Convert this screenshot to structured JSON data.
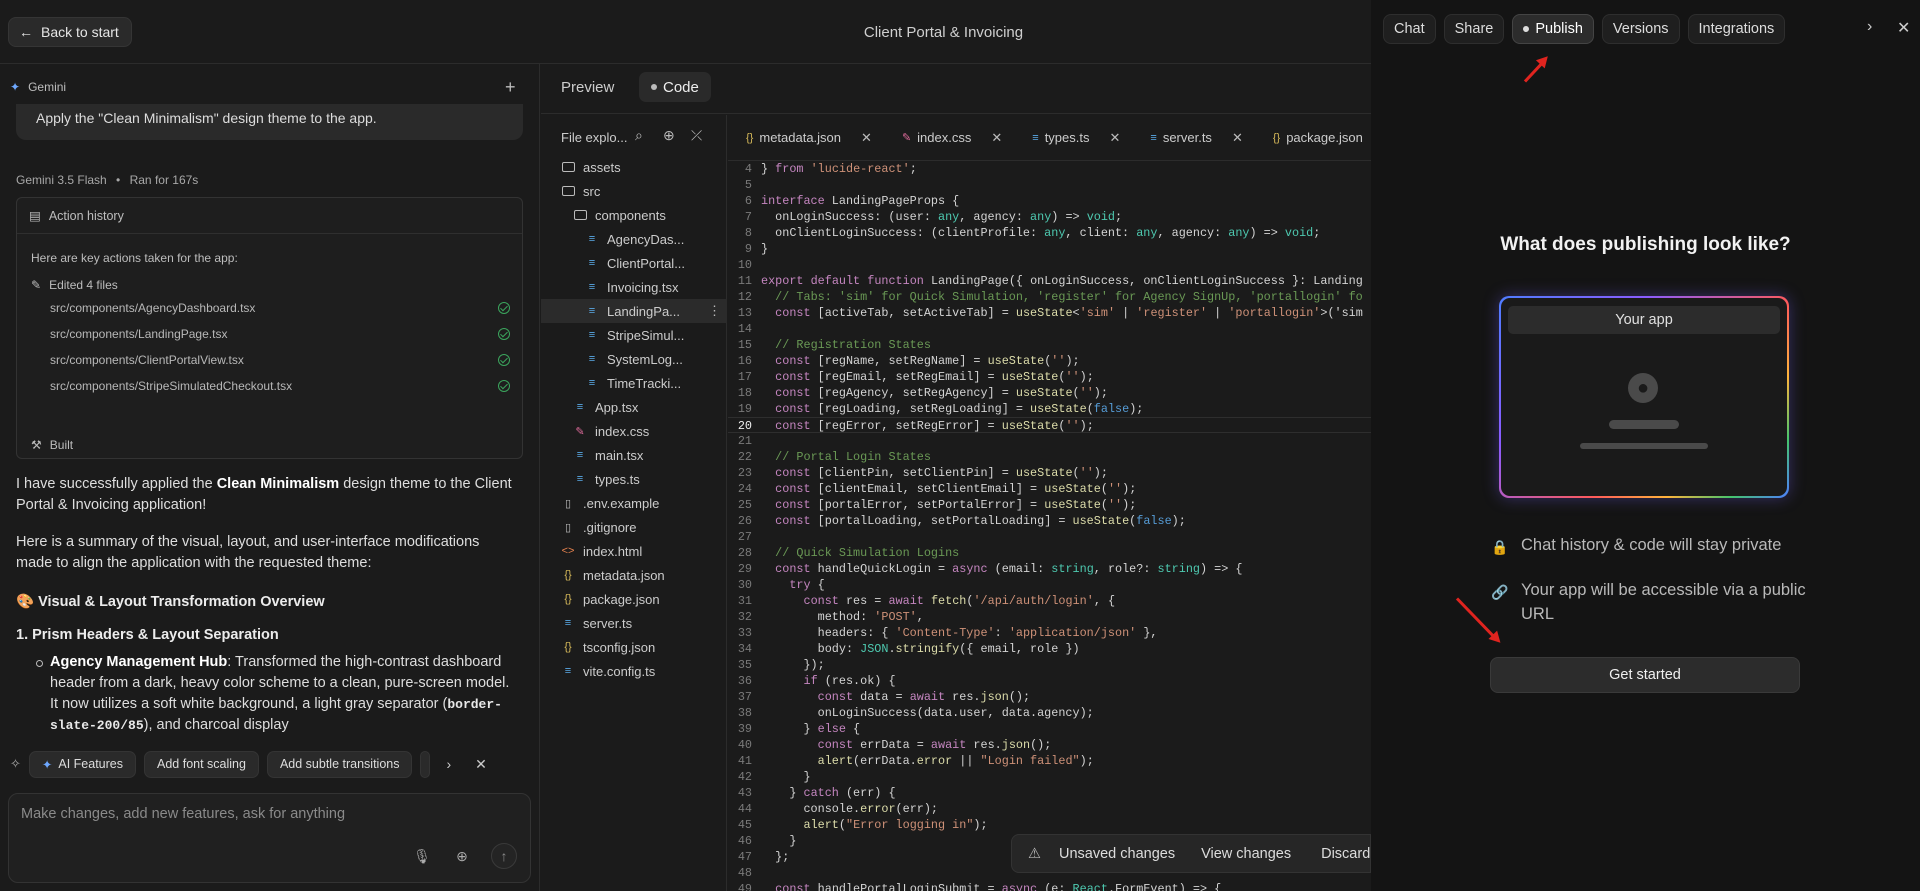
{
  "topbar": {
    "back_label": "Back to start",
    "app_title": "Client Portal & Invoicing"
  },
  "left": {
    "assistant_name": "Gemini",
    "prev_message": "Apply the \"Clean Minimalism\" design theme to the app.",
    "model": "Gemini 3.5 Flash",
    "ran_for": "Ran for 167s",
    "action_history": {
      "title": "Action history",
      "intro": "Here are key actions taken for the app:",
      "edited": "Edited 4 files",
      "files": [
        "src/components/AgencyDashboard.tsx",
        "src/components/LandingPage.tsx",
        "src/components/ClientPortalView.tsx",
        "src/components/StripeSimulatedCheckout.tsx"
      ],
      "built": "Built"
    },
    "msg": {
      "p1_a": "I have successfully applied the ",
      "p1_b": "Clean Minimalism",
      "p1_c": " design theme to the Client Portal & Invoicing application!",
      "p2": "Here is a summary of the visual, layout, and user-interface modifications made to align the application with the requested theme:",
      "overview": "🎨 Visual & Layout Transformation Overview",
      "item1": "1. Prism Headers & Layout Separation",
      "bullet_bold": "Agency Management Hub",
      "bullet_text": ": Transformed the high-contrast dashboard header from a dark, heavy color scheme to a clean, pure-screen model. It now utilizes a soft white background, a light gray separator (",
      "bullet_code": "border-slate-200/85",
      "bullet_tail": "), and charcoal display"
    },
    "suggestions": [
      "AI Features",
      "Add font scaling",
      "Add subtle transitions"
    ],
    "input_placeholder": "Make changes, add new features, ask for anything"
  },
  "mid": {
    "view_tabs": [
      "Preview",
      "Code"
    ],
    "explorer_title": "File explo...",
    "tree": [
      {
        "label": "assets",
        "type": "folder",
        "depth": 0
      },
      {
        "label": "src",
        "type": "folder",
        "depth": 0
      },
      {
        "label": "components",
        "type": "folder",
        "depth": 1
      },
      {
        "label": "AgencyDas...",
        "type": "tsx",
        "depth": 2
      },
      {
        "label": "ClientPortal...",
        "type": "tsx",
        "depth": 2
      },
      {
        "label": "Invoicing.tsx",
        "type": "tsx",
        "depth": 2
      },
      {
        "label": "LandingPa...",
        "type": "tsx",
        "depth": 2,
        "selected": true
      },
      {
        "label": "StripeSimul...",
        "type": "tsx",
        "depth": 2
      },
      {
        "label": "SystemLog...",
        "type": "tsx",
        "depth": 2
      },
      {
        "label": "TimeTracki...",
        "type": "tsx",
        "depth": 2
      },
      {
        "label": "App.tsx",
        "type": "tsx",
        "depth": 1
      },
      {
        "label": "index.css",
        "type": "css",
        "depth": 1
      },
      {
        "label": "main.tsx",
        "type": "tsx",
        "depth": 1
      },
      {
        "label": "types.ts",
        "type": "tsx",
        "depth": 1
      },
      {
        "label": ".env.example",
        "type": "file",
        "depth": 0
      },
      {
        "label": ".gitignore",
        "type": "file",
        "depth": 0
      },
      {
        "label": "index.html",
        "type": "html",
        "depth": 0
      },
      {
        "label": "metadata.json",
        "type": "json",
        "depth": 0
      },
      {
        "label": "package.json",
        "type": "json",
        "depth": 0
      },
      {
        "label": "server.ts",
        "type": "tsx",
        "depth": 0
      },
      {
        "label": "tsconfig.json",
        "type": "json",
        "depth": 0
      },
      {
        "label": "vite.config.ts",
        "type": "tsx",
        "depth": 0
      }
    ],
    "file_tabs": [
      {
        "label": "metadata.json",
        "type": "json"
      },
      {
        "label": "index.css",
        "type": "css"
      },
      {
        "label": "types.ts",
        "type": "tsx"
      },
      {
        "label": "server.ts",
        "type": "tsx"
      },
      {
        "label": "package.json",
        "type": "json"
      }
    ],
    "code_start_line": 4,
    "current_line": 20,
    "code": [
      "} from 'lucide-react';",
      "",
      "interface LandingPageProps {",
      "  onLoginSuccess: (user: any, agency: any) => void;",
      "  onClientLoginSuccess: (clientProfile: any, client: any, agency: any) => void;",
      "}",
      "",
      "export default function LandingPage({ onLoginSuccess, onClientLoginSuccess }: Landing",
      "  // Tabs: 'sim' for Quick Simulation, 'register' for Agency SignUp, 'portallogin' fo",
      "  const [activeTab, setActiveTab] = useState<'sim' | 'register' | 'portallogin'>('sim",
      "",
      "  // Registration States",
      "  const [regName, setRegName] = useState('');",
      "  const [regEmail, setRegEmail] = useState('');",
      "  const [regAgency, setRegAgency] = useState('');",
      "  const [regLoading, setRegLoading] = useState(false);",
      "  const [regError, setRegError] = useState('');",
      "",
      "  // Portal Login States",
      "  const [clientPin, setClientPin] = useState('');",
      "  const [clientEmail, setClientEmail] = useState('');",
      "  const [portalError, setPortalError] = useState('');",
      "  const [portalLoading, setPortalLoading] = useState(false);",
      "",
      "  // Quick Simulation Logins",
      "  const handleQuickLogin = async (email: string, role?: string) => {",
      "    try {",
      "      const res = await fetch('/api/auth/login', {",
      "        method: 'POST',",
      "        headers: { 'Content-Type': 'application/json' },",
      "        body: JSON.stringify({ email, role })",
      "      });",
      "      if (res.ok) {",
      "        const data = await res.json();",
      "        onLoginSuccess(data.user, data.agency);",
      "      } else {",
      "        const errData = await res.json();",
      "        alert(errData.error || \"Login failed\");",
      "      }",
      "    } catch (err) {",
      "      console.error(err);",
      "      alert(\"Error logging in\");",
      "    }",
      "  };",
      "",
      "  const handlePortalLoginSubmit = async (e: React.FormEvent) => {"
    ],
    "unsaved": {
      "label": "Unsaved changes",
      "view": "View changes",
      "discard": "Discard"
    }
  },
  "right": {
    "tabs": [
      "Chat",
      "Share",
      "Publish",
      "Versions",
      "Integrations"
    ],
    "title": "What does publishing look like?",
    "preview_label": "Your app",
    "feature1": "Chat history & code will stay private",
    "feature2": "Your app will be accessible via a public URL",
    "cta": "Get started",
    "arrow_color": "#e0241f"
  }
}
